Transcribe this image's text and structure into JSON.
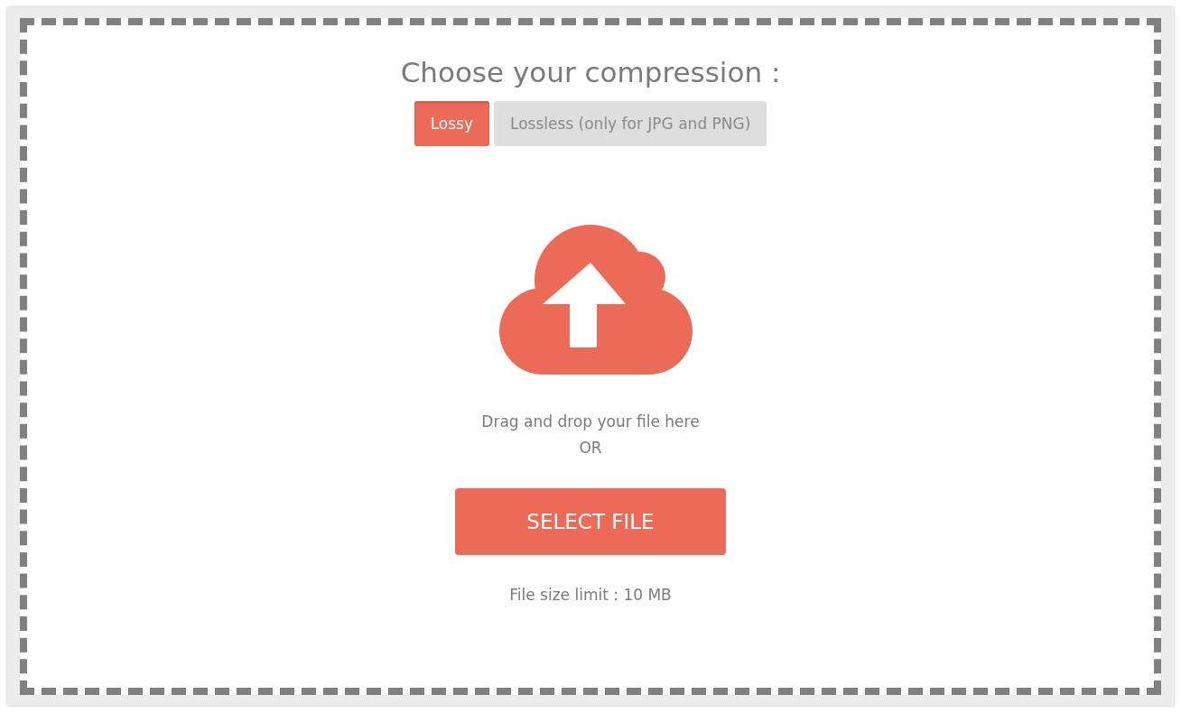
{
  "title": "Choose your compression :",
  "tabs": [
    {
      "label": "Lossy",
      "selected": true
    },
    {
      "label": "Lossless (only for JPG and PNG)",
      "selected": false
    }
  ],
  "drop_hint": "Drag and drop your file here",
  "or_text": "OR",
  "select_button": "SELECT FILE",
  "size_limit": "File size limit : 10 MB"
}
